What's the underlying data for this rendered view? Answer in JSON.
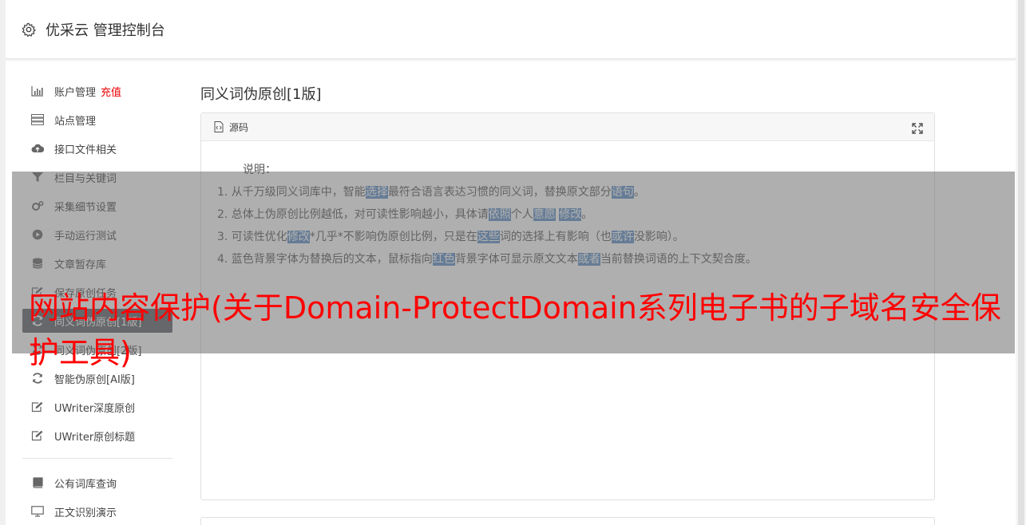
{
  "header": {
    "title": "优采云 管理控制台",
    "icon": "gear-icon"
  },
  "sidebar": {
    "items": [
      {
        "label": "账户管理",
        "extra": "充值",
        "icon": "bar-chart-icon"
      },
      {
        "label": "站点管理",
        "icon": "server-icon"
      },
      {
        "label": "接口文件相关",
        "icon": "cloud-upload-icon"
      },
      {
        "label": "栏目与关键词",
        "icon": "filter-icon"
      },
      {
        "label": "采集细节设置",
        "icon": "gears-icon"
      },
      {
        "label": "手动运行测试",
        "icon": "play-circle-icon"
      },
      {
        "label": "文章暂存库",
        "icon": "database-icon"
      },
      {
        "label": "保存原创任务",
        "icon": "edit-icon"
      },
      {
        "label": "同义词伪原创[1版]",
        "icon": "refresh-icon",
        "active": true
      },
      {
        "label": "同义词伪原创[2版]",
        "icon": "refresh-icon"
      },
      {
        "label": "智能伪原创[AI版]",
        "icon": "refresh-icon"
      },
      {
        "label": "UWriter深度原创",
        "icon": "edit-icon"
      },
      {
        "label": "UWriter原创标题",
        "icon": "edit-icon"
      },
      {
        "label": "公有词库查询",
        "icon": "book-icon"
      },
      {
        "label": "正文识别演示",
        "icon": "monitor-icon"
      }
    ]
  },
  "main": {
    "page_title": "同义词伪原创[1版]",
    "card_title": "源码",
    "explain_label": "说明：",
    "lines": [
      [
        "1. 从千万级同义词库中，智能",
        {
          "hl": "选择"
        },
        "最符合语言表达习惯的同义词，替换原文部分",
        {
          "hl": "语句"
        },
        "。"
      ],
      [
        "2. 总体上伪原创比例越低，对可读性影响越小，具体请",
        {
          "hl": "依照"
        },
        "个人",
        {
          "hl": "意愿"
        },
        " ",
        {
          "hl": "修改"
        },
        "。"
      ],
      [
        "3. 可读性优化",
        {
          "hl": "修改"
        },
        "*几乎*不影响伪原创比例，只是在",
        {
          "hl": "这些"
        },
        "词的选择上有影响（也",
        {
          "hl": "或许"
        },
        "没影响）。"
      ],
      [
        "4. 蓝色背景字体为替换后的文本，鼠标指向",
        {
          "hl": "红色"
        },
        "背景字体可显示原文文本",
        {
          "hl": "或者"
        },
        "当前替换词语的上下文契合度。"
      ]
    ]
  },
  "overlay": {
    "text": "网站内容保护(关于Domain-ProtectDomain系列电子书的子域名安全保护工具)"
  },
  "colors": {
    "highlight": "#5d8fc8",
    "recharge": "#e00000",
    "overlay_text": "#ff0000",
    "active_nav": "#5b5f66"
  }
}
